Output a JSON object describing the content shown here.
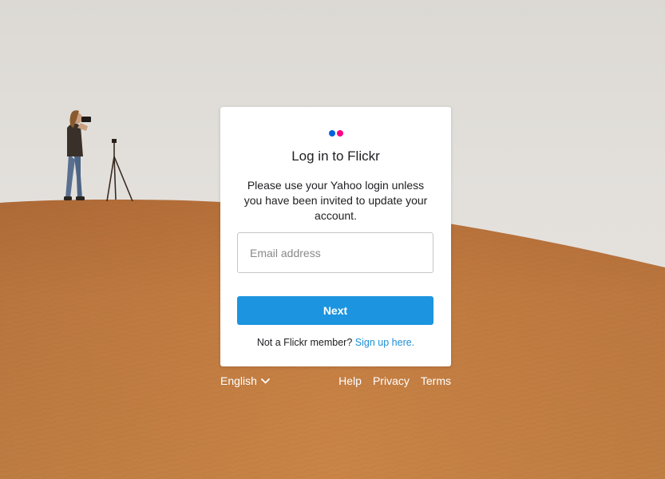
{
  "colors": {
    "logo_blue": "#0063dc",
    "logo_pink": "#ff0084",
    "button_blue": "#1c94e0",
    "link_blue": "#1c8fd6",
    "sand": "#c27a40",
    "sky": "#e2dfdb"
  },
  "card": {
    "logo_icon": "flickr-dots-icon",
    "title": "Log in to Flickr",
    "subtitle": "Please use your Yahoo login unless you have been invited to update your account.",
    "email": {
      "value": "",
      "placeholder": "Email address"
    },
    "next_label": "Next",
    "signup_prompt": "Not a Flickr member?",
    "signup_link": "Sign up here."
  },
  "footer": {
    "language": "English",
    "language_icon": "chevron-down-icon",
    "links": {
      "help": "Help",
      "privacy": "Privacy",
      "terms": "Terms"
    }
  }
}
